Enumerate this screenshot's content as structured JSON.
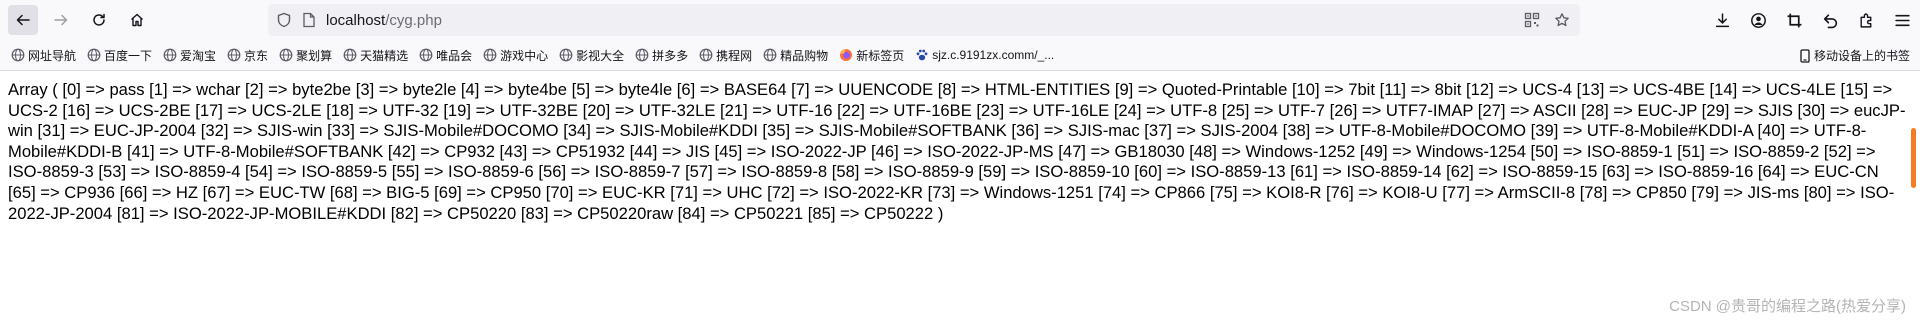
{
  "browser": {
    "url_host": "localhost",
    "url_path": "/cyg.php"
  },
  "icons": {
    "back": "arrow-left-icon",
    "forward": "arrow-right-icon",
    "reload": "reload-icon",
    "home": "home-icon",
    "shield": "shield-icon",
    "page": "page-icon",
    "qr": "qr-code-icon",
    "star": "star-icon",
    "download": "download-icon",
    "account": "account-icon",
    "crop": "crop-icon",
    "undo": "undo-icon",
    "extensions": "extensions-icon",
    "menu": "hamburger-menu-icon"
  },
  "bookmarks": [
    {
      "label": "网址导航",
      "icon": "globe-icon"
    },
    {
      "label": "百度一下",
      "icon": "globe-icon"
    },
    {
      "label": "爱淘宝",
      "icon": "globe-icon"
    },
    {
      "label": "京东",
      "icon": "globe-icon"
    },
    {
      "label": "聚划算",
      "icon": "globe-icon"
    },
    {
      "label": "天猫精选",
      "icon": "globe-icon"
    },
    {
      "label": "唯品会",
      "icon": "globe-icon"
    },
    {
      "label": "游戏中心",
      "icon": "globe-icon"
    },
    {
      "label": "影视大全",
      "icon": "globe-icon"
    },
    {
      "label": "拼多多",
      "icon": "globe-icon"
    },
    {
      "label": "携程网",
      "icon": "globe-icon"
    },
    {
      "label": "精品购物",
      "icon": "globe-icon"
    },
    {
      "label": "新标签页",
      "icon": "firefox-icon"
    },
    {
      "label": "sjz.c.9191zx.comm/_...",
      "icon": "paw-icon"
    }
  ],
  "mobile_bookmarks": "移动设备上的书签",
  "content": {
    "output": "Array ( [0] => pass [1] => wchar [2] => byte2be [3] => byte2le [4] => byte4be [5] => byte4le [6] => BASE64 [7] => UUENCODE [8] => HTML-ENTITIES [9] => Quoted-Printable [10] => 7bit [11] => 8bit [12] => UCS-4 [13] => UCS-4BE [14] => UCS-4LE [15] => UCS-2 [16] => UCS-2BE [17] => UCS-2LE [18] => UTF-32 [19] => UTF-32BE [20] => UTF-32LE [21] => UTF-16 [22] => UTF-16BE [23] => UTF-16LE [24] => UTF-8 [25] => UTF-7 [26] => UTF7-IMAP [27] => ASCII [28] => EUC-JP [29] => SJIS [30] => eucJP-win [31] => EUC-JP-2004 [32] => SJIS-win [33] => SJIS-Mobile#DOCOMO [34] => SJIS-Mobile#KDDI [35] => SJIS-Mobile#SOFTBANK [36] => SJIS-mac [37] => SJIS-2004 [38] => UTF-8-Mobile#DOCOMO [39] => UTF-8-Mobile#KDDI-A [40] => UTF-8-Mobile#KDDI-B [41] => UTF-8-Mobile#SOFTBANK [42] => CP932 [43] => CP51932 [44] => JIS [45] => ISO-2022-JP [46] => ISO-2022-JP-MS [47] => GB18030 [48] => Windows-1252 [49] => Windows-1254 [50] => ISO-8859-1 [51] => ISO-8859-2 [52] => ISO-8859-3 [53] => ISO-8859-4 [54] => ISO-8859-5 [55] => ISO-8859-6 [56] => ISO-8859-7 [57] => ISO-8859-8 [58] => ISO-8859-9 [59] => ISO-8859-10 [60] => ISO-8859-13 [61] => ISO-8859-14 [62] => ISO-8859-15 [63] => ISO-8859-16 [64] => EUC-CN [65] => CP936 [66] => HZ [67] => EUC-TW [68] => BIG-5 [69] => CP950 [70] => EUC-KR [71] => UHC [72] => ISO-2022-KR [73] => Windows-1251 [74] => CP866 [75] => KOI8-R [76] => KOI8-U [77] => ArmSCII-8 [78] => CP850 [79] => JIS-ms [80] => ISO-2022-JP-2004 [81] => ISO-2022-JP-MOBILE#KDDI [82] => CP50220 [83] => CP50220raw [84] => CP50221 [85] => CP50222 )"
  },
  "watermark": "CSDN @贵哥的编程之路(热爱分享)",
  "colors": {
    "scroll_thumb": "#f47c22",
    "toolbar_bg": "#f9f9fb",
    "urlbar_bg": "#f0f0f4"
  }
}
